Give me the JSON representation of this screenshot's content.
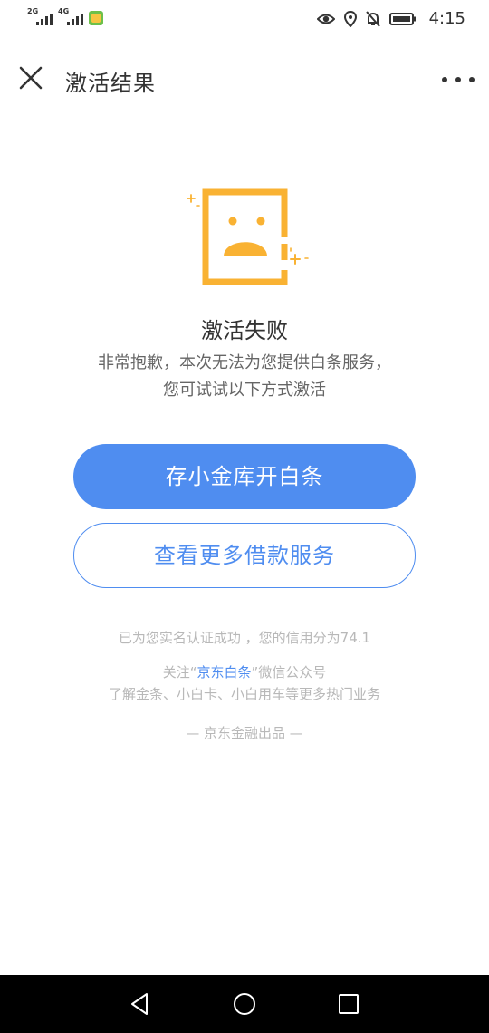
{
  "status_bar": {
    "signal_1_label": "2G",
    "signal_2_label": "4G",
    "time": "4:15",
    "icons": [
      "eye-icon",
      "location-icon",
      "bell-off-icon",
      "battery-icon"
    ]
  },
  "nav": {
    "title": "激活结果",
    "close_icon": "close-icon",
    "more_icon": "more-icon"
  },
  "result": {
    "icon": "sad-card-icon",
    "title": "激活失败",
    "desc_line1": "非常抱歉，本次无法为您提供白条服务，",
    "desc_line2": "您可试试以下方式激活"
  },
  "buttons": {
    "primary_label": "存小金库开白条",
    "secondary_label": "查看更多借款服务"
  },
  "footer": {
    "credit_text": "已为您实名认证成功 ，您的信用分为74.1",
    "follow_prefix": "关注“",
    "follow_link": "京东白条",
    "follow_suffix": "”微信公众号",
    "promo_text": "了解金条、小白卡、小白用车等更多热门业务",
    "brand_text": "— 京东金融出品 —"
  },
  "system_nav": {
    "icons": [
      "back-icon",
      "home-icon",
      "recents-icon"
    ]
  },
  "colors": {
    "accent": "#4f8df0",
    "illustration": "#f9b233",
    "muted_text": "#b8b8b8"
  }
}
